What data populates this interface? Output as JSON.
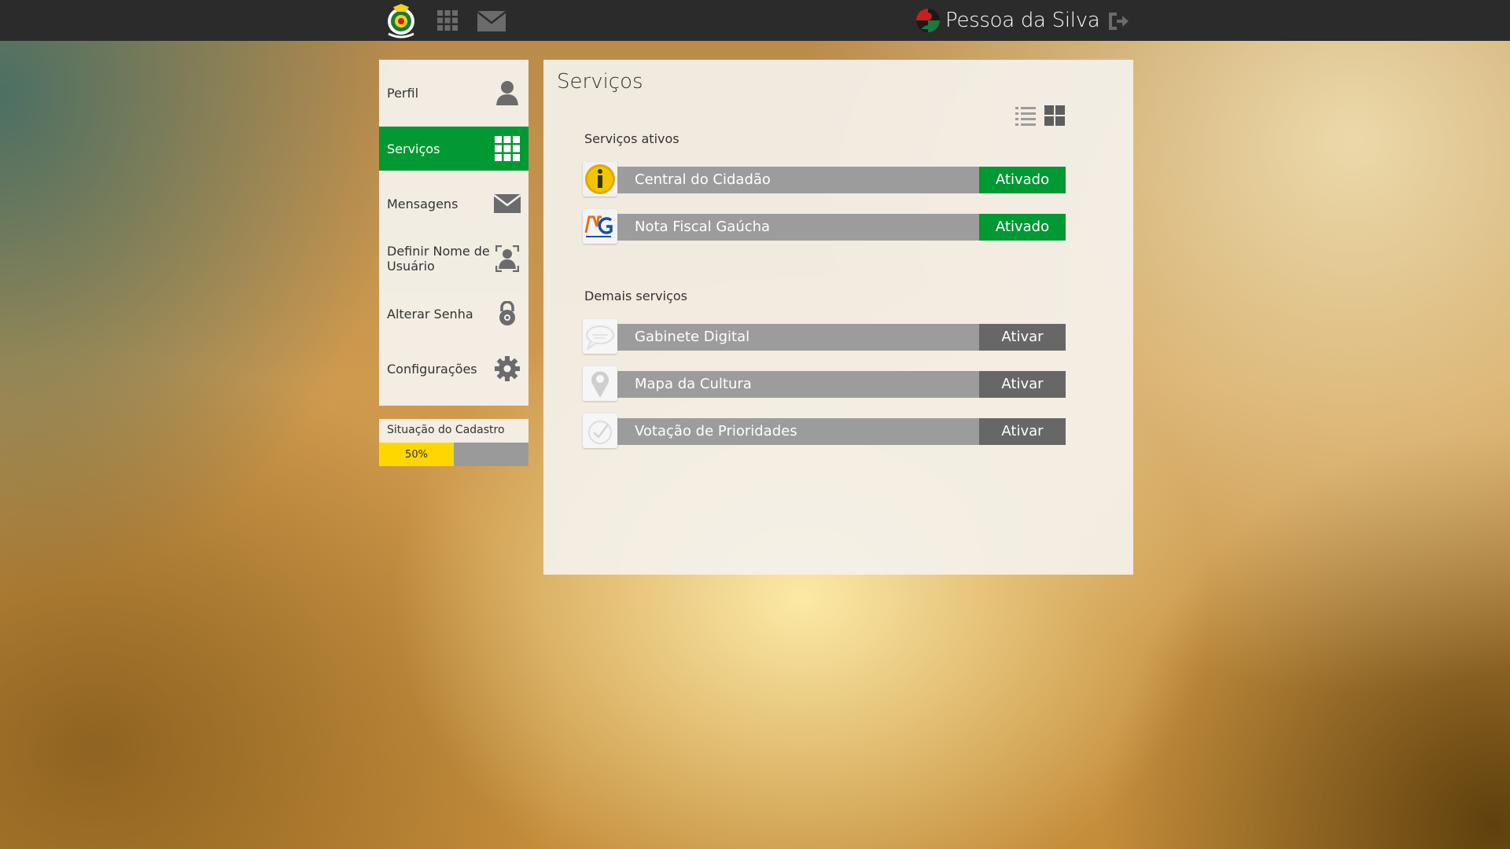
{
  "topbar": {
    "user_name": "Pessoa da Silva"
  },
  "sidebar": {
    "items": [
      {
        "label": "Perfil",
        "icon": "user-icon",
        "active": false
      },
      {
        "label": "Serviços",
        "icon": "grid-icon",
        "active": true
      },
      {
        "label": "Mensagens",
        "icon": "envelope-icon",
        "active": false
      },
      {
        "label": "Definir Nome de Usuário",
        "icon": "user-frame-icon",
        "active": false
      },
      {
        "label": "Alterar Senha",
        "icon": "lock-icon",
        "active": false
      },
      {
        "label": "Configurações",
        "icon": "gear-icon",
        "active": false
      }
    ]
  },
  "cadastro": {
    "title": "Situação do Cadastro",
    "progress_label": "50%",
    "progress": 0.5
  },
  "main": {
    "title": "Serviços",
    "active_section": {
      "label": "Serviços ativos",
      "services": [
        {
          "name": "Central do Cidadão",
          "status": "Ativado",
          "icon": "info-icon"
        },
        {
          "name": "Nota Fiscal Gaúcha",
          "status": "Ativado",
          "icon": "nfg-logo-icon"
        }
      ]
    },
    "other_section": {
      "label": "Demais serviços",
      "services": [
        {
          "name": "Gabinete Digital",
          "status": "Ativar",
          "icon": "chat-bubble-icon"
        },
        {
          "name": "Mapa da Cultura",
          "status": "Ativar",
          "icon": "map-pin-icon"
        },
        {
          "name": "Votação de Prioridades",
          "status": "Ativar",
          "icon": "vote-icon"
        }
      ]
    }
  },
  "colors": {
    "accent_green": "#009933",
    "progress_yellow": "#ffd700",
    "topbar": "#2b2b2b"
  }
}
